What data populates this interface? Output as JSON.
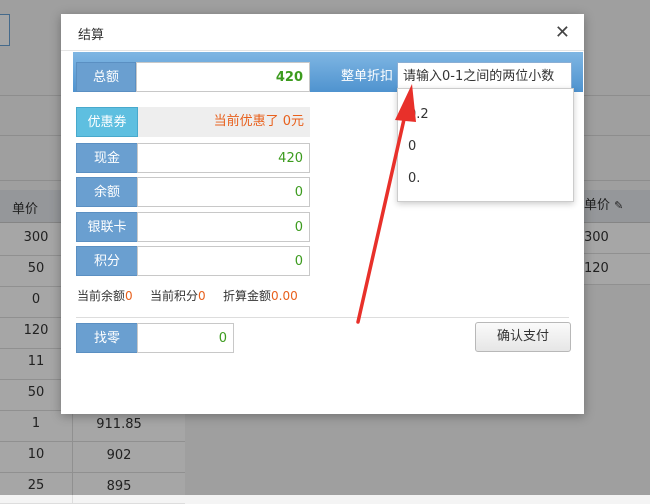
{
  "background": {
    "unit_price_header": "单价",
    "rows": [
      {
        "price": "300",
        "amount": ""
      },
      {
        "price": "50",
        "amount": ""
      },
      {
        "price": "0",
        "amount": ""
      },
      {
        "price": "120",
        "amount": ""
      },
      {
        "price": "11",
        "amount": ""
      },
      {
        "price": "50",
        "amount": ""
      },
      {
        "price": "1",
        "amount": "911.85"
      },
      {
        "price": "10",
        "amount": "902"
      },
      {
        "price": "25",
        "amount": "895"
      }
    ],
    "right_header": "单价",
    "right_rows": [
      "300",
      "120"
    ]
  },
  "modal": {
    "title": "结算",
    "total_label": "总额",
    "total_value": "420",
    "discount_label": "整单折扣",
    "discount_placeholder": "请输入0-1之间的两位小数",
    "discount_options": [
      "0.2",
      "0",
      "0."
    ],
    "coupon_label": "优惠券",
    "coupon_text": "当前优惠了 0元",
    "cash_label": "现金",
    "cash_value": "420",
    "balance_label": "余额",
    "balance_value": "0",
    "unionpay_label": "银联卡",
    "unionpay_value": "0",
    "points_label": "积分",
    "points_value": "0",
    "current_balance_label": "当前余额",
    "current_balance_value": "0",
    "current_points_label": "当前积分",
    "current_points_value": "0",
    "discount_amount_label": "折算金额",
    "discount_amount_value": "0.00",
    "change_label": "找零",
    "change_value": "0",
    "confirm_label": "确认支付"
  },
  "colors": {
    "label_blue": "#6a9fd0",
    "coupon_cyan": "#5ebfe0",
    "value_green": "#3c9b1e",
    "highlight_orange": "#e8601c",
    "arrow_red": "#e8302a"
  },
  "icons": {
    "close": "close-icon",
    "edit": "pencil-icon"
  }
}
